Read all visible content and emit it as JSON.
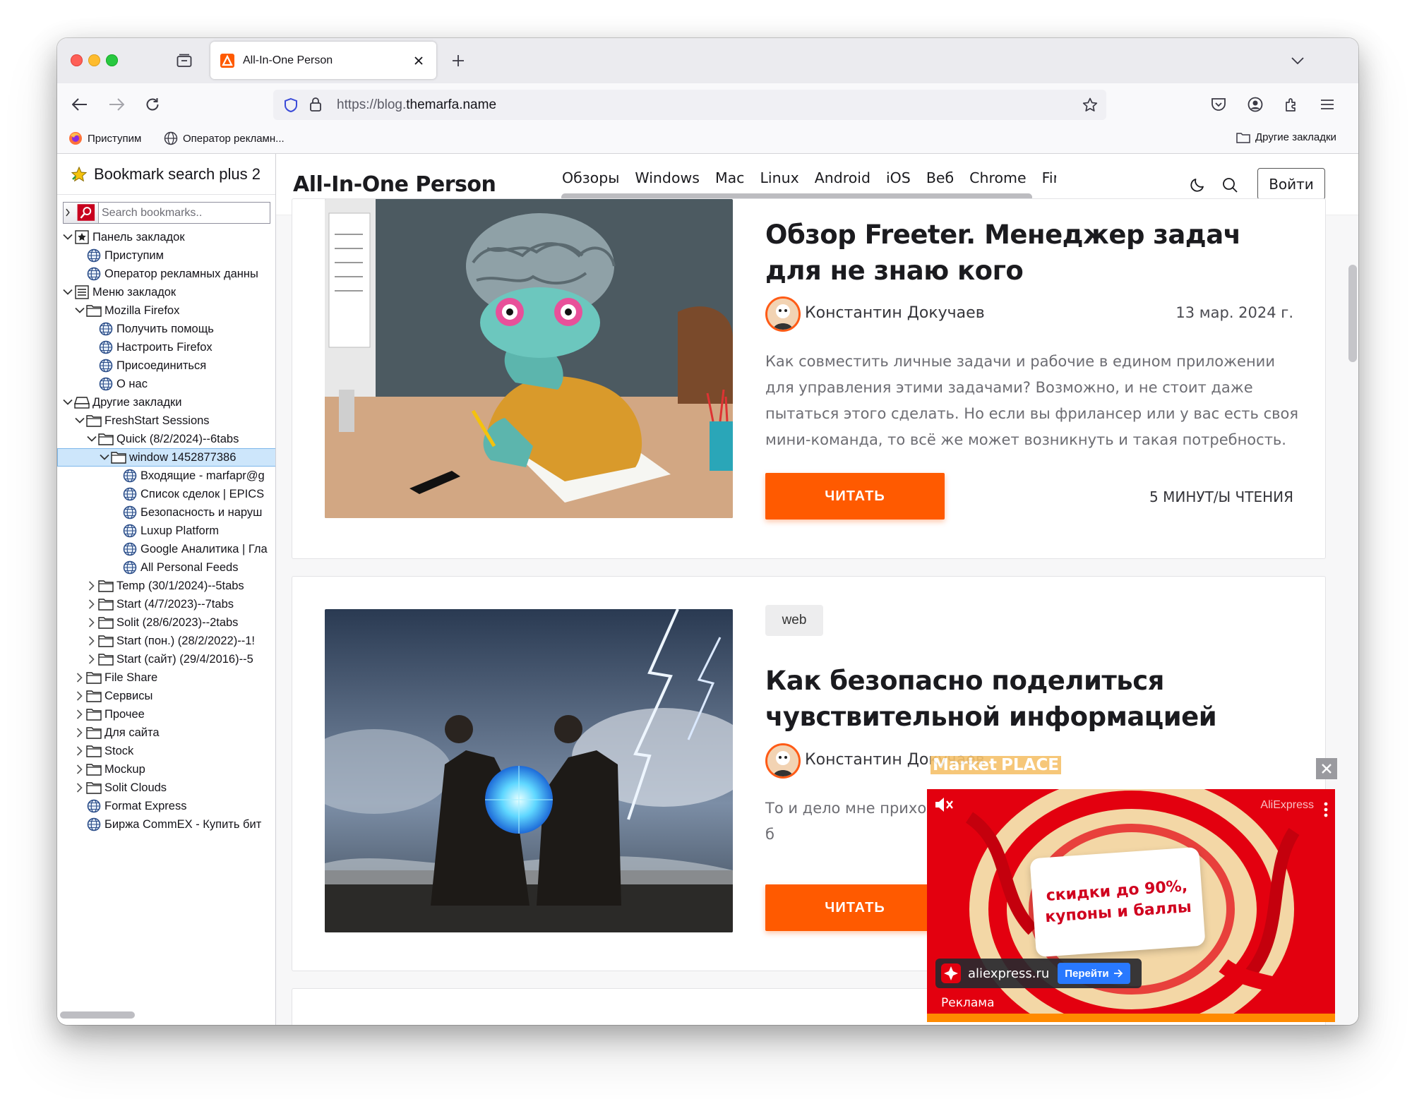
{
  "browser": {
    "tab_title": "All-In-One Person",
    "url_prefix": "https://blog.",
    "url_domain": "themarfa.name",
    "bookmarks_bar": {
      "items": [
        "Приступим",
        "Оператор рекламн..."
      ],
      "other": "Другие закладки"
    }
  },
  "sidebar": {
    "title": "Bookmark search plus 2",
    "search_placeholder": "Search bookmarks..",
    "tree": [
      {
        "label": "Панель закладок",
        "level": 0,
        "twisty": "open",
        "icon": "toolbar-star-icon"
      },
      {
        "label": "Приступим",
        "level": 1,
        "twisty": "none",
        "icon": "globe-icon"
      },
      {
        "label": "Оператор рекламных данны",
        "level": 1,
        "twisty": "none",
        "icon": "globe-icon"
      },
      {
        "label": "Меню закладок",
        "level": 0,
        "twisty": "open",
        "icon": "menu-list-icon"
      },
      {
        "label": "Mozilla Firefox",
        "level": 1,
        "twisty": "open",
        "icon": "folder-icon"
      },
      {
        "label": "Получить помощь",
        "level": 2,
        "twisty": "none",
        "icon": "globe-icon"
      },
      {
        "label": "Настроить Firefox",
        "level": 2,
        "twisty": "none",
        "icon": "globe-icon"
      },
      {
        "label": "Присоединиться",
        "level": 2,
        "twisty": "none",
        "icon": "globe-icon"
      },
      {
        "label": "О нас",
        "level": 2,
        "twisty": "none",
        "icon": "globe-icon"
      },
      {
        "label": "Другие закладки",
        "level": 0,
        "twisty": "open",
        "icon": "other-bookmarks-icon"
      },
      {
        "label": "FreshStart Sessions",
        "level": 1,
        "twisty": "open",
        "icon": "folder-icon"
      },
      {
        "label": "Quick (8/2/2024)--6tabs",
        "level": 2,
        "twisty": "open",
        "icon": "folder-icon"
      },
      {
        "label": "window 1452877386",
        "level": 3,
        "twisty": "open",
        "icon": "folder-icon",
        "selected": true
      },
      {
        "label": "Входящие - marfapr@g",
        "level": 4,
        "twisty": "none",
        "icon": "globe-icon"
      },
      {
        "label": "Список сделок | EPICS",
        "level": 4,
        "twisty": "none",
        "icon": "globe-icon"
      },
      {
        "label": "Безопасность и наруш",
        "level": 4,
        "twisty": "none",
        "icon": "globe-icon"
      },
      {
        "label": "Luxup Platform",
        "level": 4,
        "twisty": "none",
        "icon": "globe-icon"
      },
      {
        "label": "Google Аналитика | Гла",
        "level": 4,
        "twisty": "none",
        "icon": "globe-icon"
      },
      {
        "label": "All Personal Feeds",
        "level": 4,
        "twisty": "none",
        "icon": "globe-icon"
      },
      {
        "label": "Temp (30/1/2024)--5tabs",
        "level": 2,
        "twisty": "closed",
        "icon": "folder-icon"
      },
      {
        "label": "Start (4/7/2023)--7tabs",
        "level": 2,
        "twisty": "closed",
        "icon": "folder-icon"
      },
      {
        "label": "Solit (28/6/2023)--2tabs",
        "level": 2,
        "twisty": "closed",
        "icon": "folder-icon"
      },
      {
        "label": "Start (пон.) (28/2/2022)--1!",
        "level": 2,
        "twisty": "closed",
        "icon": "folder-icon"
      },
      {
        "label": "Start (сайт) (29/4/2016)--5",
        "level": 2,
        "twisty": "closed",
        "icon": "folder-icon"
      },
      {
        "label": "File Share",
        "level": 1,
        "twisty": "closed",
        "icon": "folder-icon"
      },
      {
        "label": "Сервисы",
        "level": 1,
        "twisty": "closed",
        "icon": "folder-icon"
      },
      {
        "label": "Прочее",
        "level": 1,
        "twisty": "closed",
        "icon": "folder-icon"
      },
      {
        "label": "Для сайта",
        "level": 1,
        "twisty": "closed",
        "icon": "folder-icon"
      },
      {
        "label": "Stock",
        "level": 1,
        "twisty": "closed",
        "icon": "folder-icon"
      },
      {
        "label": "Mockup",
        "level": 1,
        "twisty": "closed",
        "icon": "folder-icon"
      },
      {
        "label": "Solit Clouds",
        "level": 1,
        "twisty": "closed",
        "icon": "folder-icon"
      },
      {
        "label": "Format Express",
        "level": 1,
        "twisty": "none",
        "icon": "globe-icon"
      },
      {
        "label": "Биржа CommEX - Купить бит",
        "level": 1,
        "twisty": "none",
        "icon": "globe-icon"
      }
    ]
  },
  "site": {
    "brand": "All-In-One Person",
    "nav": [
      "Обзоры",
      "Windows",
      "Mac",
      "Linux",
      "Android",
      "iOS",
      "Веб",
      "Chrome",
      "Firefox"
    ],
    "login": "Войти"
  },
  "posts": [
    {
      "title": "Обзор Freeter. Менеджер задач для не знаю кого",
      "author": "Константин Докучаев",
      "date": "13 мар. 2024 г.",
      "excerpt": "Как совместить личные задачи и рабочие в едином приложении для управления этими задачами? Возможно, и не стоит даже пытаться этого сделать. Но если вы фрилансер или у вас есть своя мини-команда, то всё же может возникнуть и такая потребность.",
      "read_label": "ЧИТАТЬ",
      "read_time": "5 МИНУТ/Ы ЧТЕНИЯ"
    },
    {
      "tag": "web",
      "title": "Как безопасно поделиться чувствительной информацией",
      "author": "Константин Докучаев",
      "excerpt": "То и дело мне приходи аналога Netflix, перед такое, что не стоило б",
      "read_label": "ЧИТАТЬ"
    }
  ],
  "ad": {
    "overlay_label": "Market",
    "overlay_accent": "PLACE",
    "brand": "AliExpress",
    "promo": "скидки до 90%, купоны и баллы",
    "site": "aliexpress.ru",
    "cta": "Перейти",
    "label": "Реклама"
  },
  "colors": {
    "accent": "#ff5a00",
    "selection": "#cde6fb",
    "ad_red": "#e3000f",
    "go_blue": "#2979ff"
  }
}
